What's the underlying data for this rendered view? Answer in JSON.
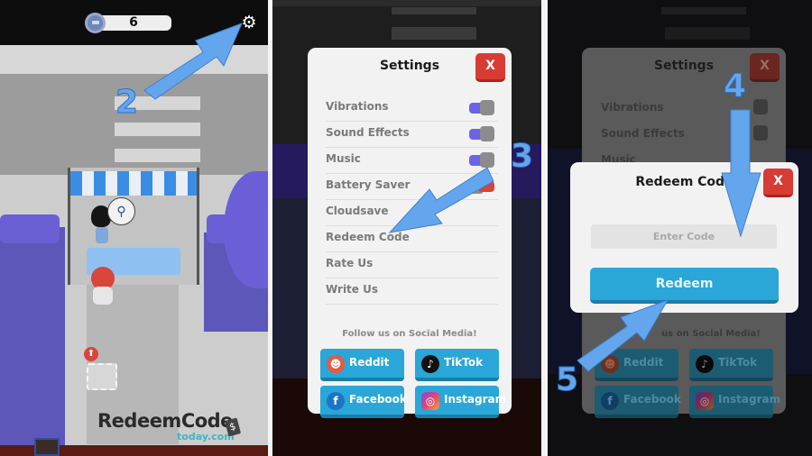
{
  "panel1": {
    "coin_count": "6",
    "settings_icon": "gear-icon",
    "step_label": "2",
    "npc_bubble_icon": "scooter-icon",
    "slot_badge_icon": "up-arrow-icon",
    "watermark": {
      "brand": "RedeemCode",
      "sub": "today.com",
      "tag": "$"
    }
  },
  "panel2": {
    "step_label": "3",
    "settings": {
      "title": "Settings",
      "close_label": "X",
      "items": [
        {
          "label": "Vibrations",
          "toggle": "on"
        },
        {
          "label": "Sound Effects",
          "toggle": "on"
        },
        {
          "label": "Music",
          "toggle": "on"
        },
        {
          "label": "Battery Saver",
          "toggle": "off"
        },
        {
          "label": "Cloudsave"
        },
        {
          "label": "Redeem Code"
        },
        {
          "label": "Rate Us"
        },
        {
          "label": "Write Us"
        }
      ],
      "social_caption": "Follow us on Social Media!",
      "social": [
        {
          "label": "Reddit",
          "icon": "reddit-icon",
          "glyph": "☻"
        },
        {
          "label": "TikTok",
          "icon": "tiktok-icon",
          "glyph": "♪"
        },
        {
          "label": "Facebook",
          "icon": "facebook-icon",
          "glyph": "f"
        },
        {
          "label": "Instagram",
          "icon": "instagram-icon",
          "glyph": "◎"
        }
      ]
    }
  },
  "panel3": {
    "step_label_top": "4",
    "step_label_bottom": "5",
    "background_settings": {
      "title": "Settings",
      "close_label": "X",
      "items": [
        "Vibrations",
        "Sound Effects",
        "Music"
      ],
      "social_caption_partial": "us on Social Media!",
      "social": [
        {
          "label": "Reddit",
          "glyph": "☻"
        },
        {
          "label": "TikTok",
          "glyph": "♪"
        },
        {
          "label": "Facebook",
          "glyph": "f"
        },
        {
          "label": "Instagram",
          "glyph": "◎"
        }
      ]
    },
    "redeem": {
      "title": "Redeem Code",
      "close_label": "X",
      "input_placeholder": "Enter Code",
      "input_value": "",
      "button_label": "Redeem"
    }
  },
  "colors": {
    "accent_blue": "#2aa7d8",
    "close_red": "#d83b33",
    "toggle_purple": "#6c63e6",
    "arrow_blue": "#64a6ee"
  }
}
